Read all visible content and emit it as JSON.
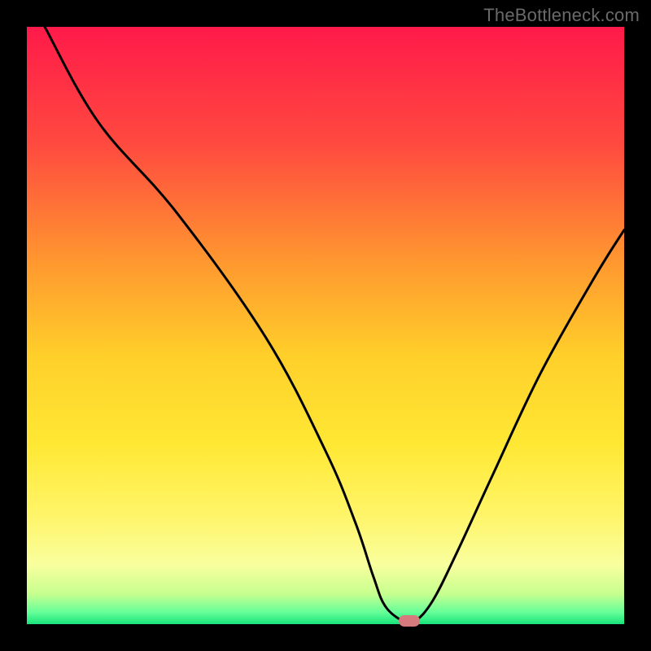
{
  "watermark": "TheBottleneck.com",
  "chart_data": {
    "type": "line",
    "title": "",
    "xlabel": "",
    "ylabel": "",
    "xlim": [
      0,
      100
    ],
    "ylim": [
      0,
      100
    ],
    "series": [
      {
        "name": "curve",
        "x": [
          3,
          12,
          25,
          40,
          50,
          55,
          58,
          60,
          63,
          65,
          68,
          72,
          78,
          86,
          95,
          100
        ],
        "y": [
          100,
          84,
          69,
          48,
          29,
          17,
          8,
          3,
          0.5,
          0.5,
          4,
          12,
          25,
          42,
          58,
          66
        ]
      }
    ],
    "gradient_stops": [
      {
        "offset": 0,
        "color": "#ff1a4a"
      },
      {
        "offset": 20,
        "color": "#ff4b3f"
      },
      {
        "offset": 40,
        "color": "#ff9a2f"
      },
      {
        "offset": 55,
        "color": "#ffcf2a"
      },
      {
        "offset": 70,
        "color": "#ffe834"
      },
      {
        "offset": 82,
        "color": "#fff56a"
      },
      {
        "offset": 90,
        "color": "#f9ff9e"
      },
      {
        "offset": 95,
        "color": "#c6ff8f"
      },
      {
        "offset": 98,
        "color": "#66ff99"
      },
      {
        "offset": 100,
        "color": "#18e37a"
      }
    ],
    "marker": {
      "x": 64,
      "y": 0.5
    }
  }
}
